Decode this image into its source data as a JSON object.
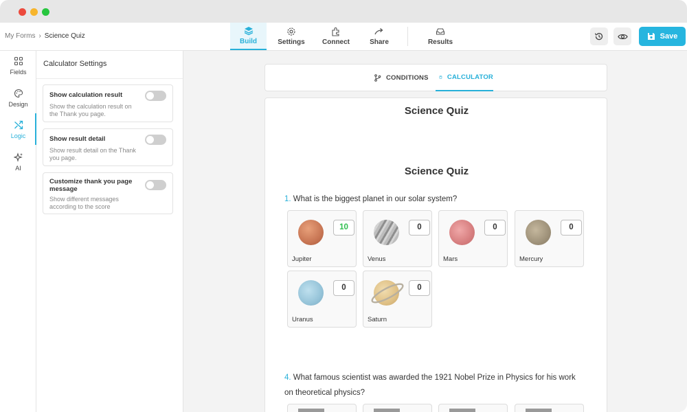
{
  "breadcrumb": {
    "parent": "My Forms",
    "separator": "›",
    "current": "Science Quiz"
  },
  "nav": [
    {
      "label": "Build",
      "icon": "layers-icon",
      "active": true
    },
    {
      "label": "Settings",
      "icon": "gear-icon",
      "active": false
    },
    {
      "label": "Connect",
      "icon": "puzzle-icon",
      "active": false
    },
    {
      "label": "Share",
      "icon": "share-arrow-icon",
      "active": false
    },
    {
      "label": "Results",
      "icon": "inbox-icon",
      "active": false
    }
  ],
  "toolbar": {
    "save_label": "Save"
  },
  "rail": [
    {
      "label": "Fields",
      "icon": "grid-icon"
    },
    {
      "label": "Design",
      "icon": "palette-icon"
    },
    {
      "label": "Logic",
      "icon": "shuffle-icon",
      "active": true
    },
    {
      "label": "AI",
      "icon": "sparkle-icon"
    }
  ],
  "panel": {
    "title": "Calculator Settings",
    "settings": [
      {
        "title": "Show calculation result",
        "desc": "Show the calculation result on the Thank you page.",
        "enabled": false
      },
      {
        "title": "Show result detail",
        "desc": "Show result detail on the Thank you page.",
        "enabled": false
      },
      {
        "title": "Customize thank you page message",
        "desc": "Show different messages according to the score",
        "enabled": false
      }
    ]
  },
  "tabs": [
    {
      "label": "CONDITIONS",
      "icon": "branch-icon",
      "active": false
    },
    {
      "label": "CALCULATOR",
      "icon": "calculator-icon",
      "active": true
    }
  ],
  "form": {
    "header_title": "Science Quiz",
    "title": "Science Quiz",
    "questions": [
      {
        "number": "1.",
        "text": "What is the biggest planet in our solar system?",
        "options": [
          {
            "label": "Jupiter",
            "score": "10"
          },
          {
            "label": "Venus",
            "score": "0"
          },
          {
            "label": "Mars",
            "score": "0"
          },
          {
            "label": "Mercury",
            "score": "0"
          },
          {
            "label": "Uranus",
            "score": "0"
          },
          {
            "label": "Saturn",
            "score": "0"
          }
        ]
      },
      {
        "number": "4.",
        "text": "What famous scientist was awarded the 1921 Nobel Prize in Physics for his work on theoretical physics?"
      }
    ]
  },
  "colors": {
    "accent": "#27b0d9",
    "save": "#26b5df",
    "positive_score": "#2fbf4f"
  }
}
